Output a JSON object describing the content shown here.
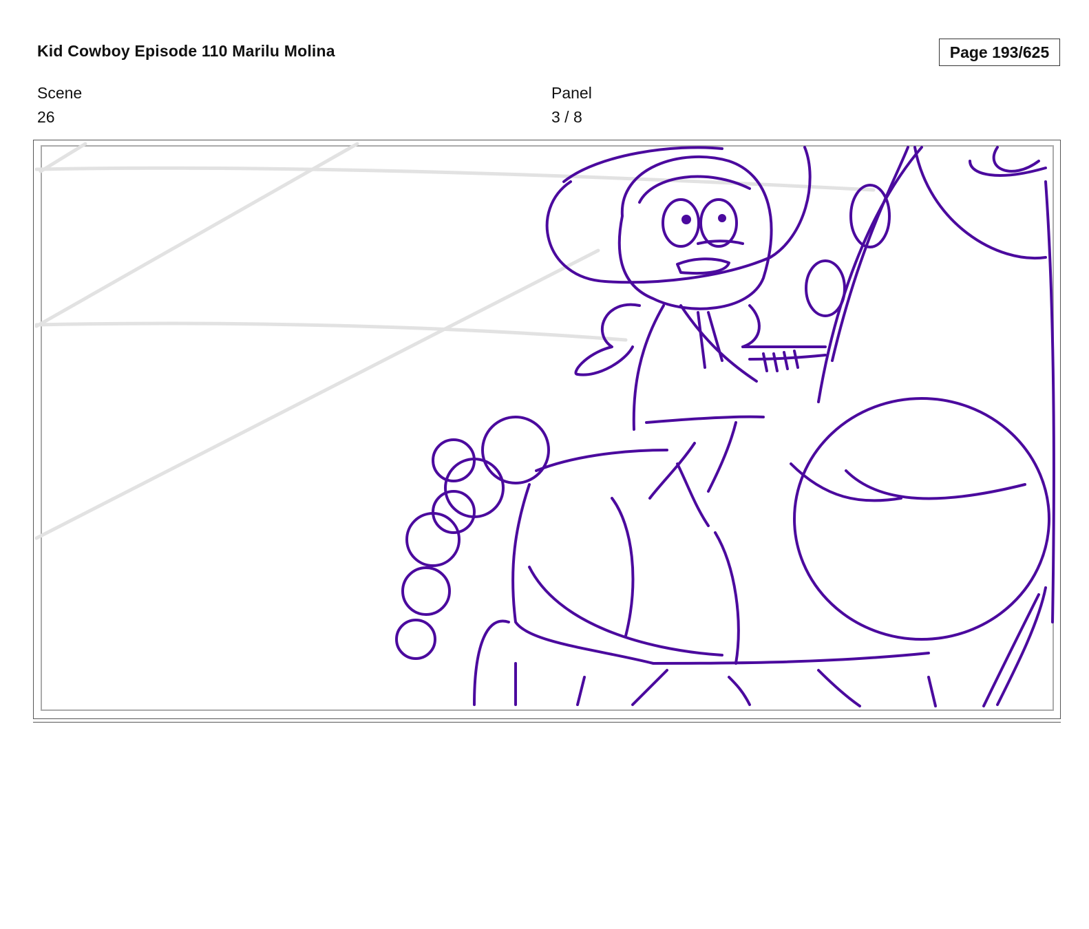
{
  "header": {
    "title": "Kid Cowboy Episode 110 Marilu Molina",
    "page": "Page 193/625"
  },
  "fields": {
    "scene_label": "Scene",
    "scene_value": "26",
    "panel_label": "Panel",
    "panel_value": "3 / 8"
  },
  "artwork": {
    "description_icon": "storyboard-sketch",
    "stroke_color": "#4B0A9E",
    "background_line_color": "#E2E2E2"
  }
}
